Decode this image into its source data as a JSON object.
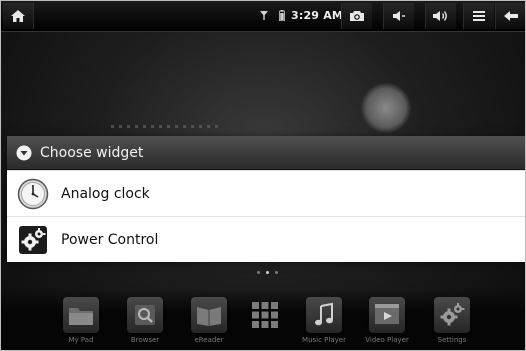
{
  "status_bar": {
    "time": "3:29 AM",
    "icons": [
      "home-icon",
      "wifi-icon",
      "battery-icon",
      "camera-icon",
      "volume-down-icon",
      "volume-up-icon",
      "menu-icon",
      "back-arrow-icon"
    ]
  },
  "dialog": {
    "title": "Choose widget",
    "items": [
      {
        "label": "Analog clock",
        "icon": "analog-clock-icon"
      },
      {
        "label": "Power Control",
        "icon": "power-control-icon"
      }
    ]
  },
  "dock": {
    "items": [
      {
        "label": "My Pad",
        "icon": "folder-icon"
      },
      {
        "label": "Browser",
        "icon": "browser-icon"
      },
      {
        "label": "eReader",
        "icon": "ereader-icon"
      },
      {
        "label": "",
        "icon": "app-grid-icon"
      },
      {
        "label": "Music Player",
        "icon": "music-note-icon"
      },
      {
        "label": "Video Player",
        "icon": "video-player-icon"
      },
      {
        "label": "Settings",
        "icon": "settings-gears-icon"
      }
    ]
  },
  "colors": {
    "dialog_header": "#3a3a3a",
    "dialog_body": "#ffffff",
    "status_bar": "#000000"
  }
}
